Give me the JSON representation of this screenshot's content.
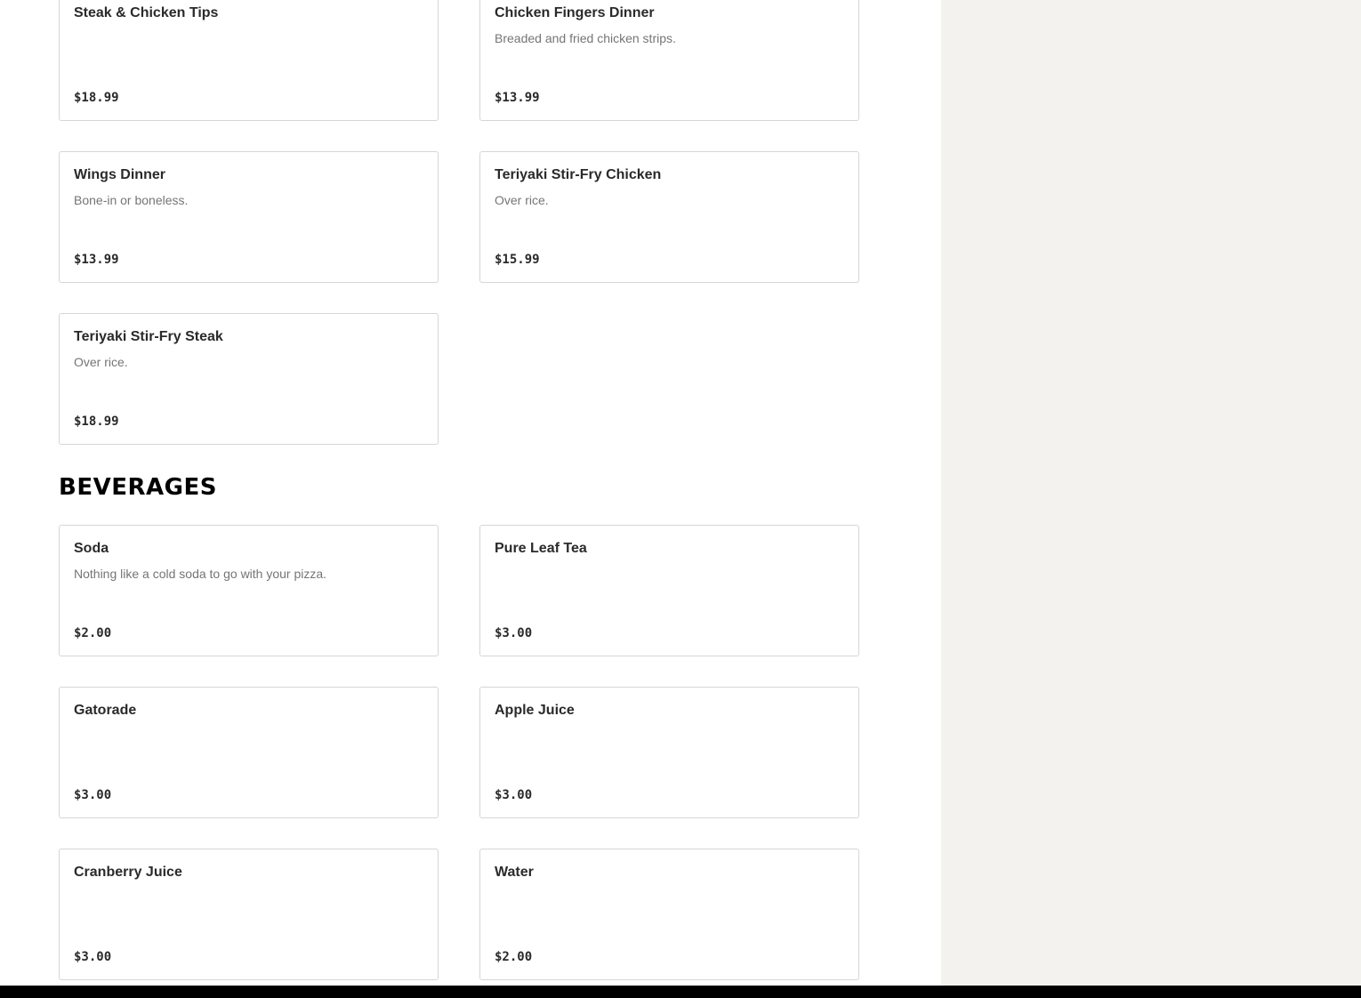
{
  "entrees_continued": {
    "items": [
      {
        "name": "Steak & Chicken Tips",
        "description": "",
        "price": "$18.99"
      },
      {
        "name": "Chicken Fingers Dinner",
        "description": "Breaded and fried chicken strips.",
        "price": "$13.99"
      },
      {
        "name": "Wings Dinner",
        "description": "Bone-in or boneless.",
        "price": "$13.99"
      },
      {
        "name": "Teriyaki Stir-Fry Chicken",
        "description": "Over rice.",
        "price": "$15.99"
      },
      {
        "name": "Teriyaki Stir-Fry Steak",
        "description": "Over rice.",
        "price": "$18.99"
      }
    ]
  },
  "beverages": {
    "title": "BEVERAGES",
    "items": [
      {
        "name": "Soda",
        "description": "Nothing like a cold soda to go with your pizza.",
        "price": "$2.00"
      },
      {
        "name": "Pure Leaf Tea",
        "description": "",
        "price": "$3.00"
      },
      {
        "name": "Gatorade",
        "description": "",
        "price": "$3.00"
      },
      {
        "name": "Apple Juice",
        "description": "",
        "price": "$3.00"
      },
      {
        "name": "Cranberry Juice",
        "description": "",
        "price": "$3.00"
      },
      {
        "name": "Water",
        "description": "",
        "price": "$2.00"
      }
    ]
  },
  "colors": {
    "page_background": "#ffffff",
    "side_panel_background": "#f3f2ef",
    "card_border": "#d6d6d6",
    "description_text": "#757575",
    "bottom_bar": "#000000"
  }
}
